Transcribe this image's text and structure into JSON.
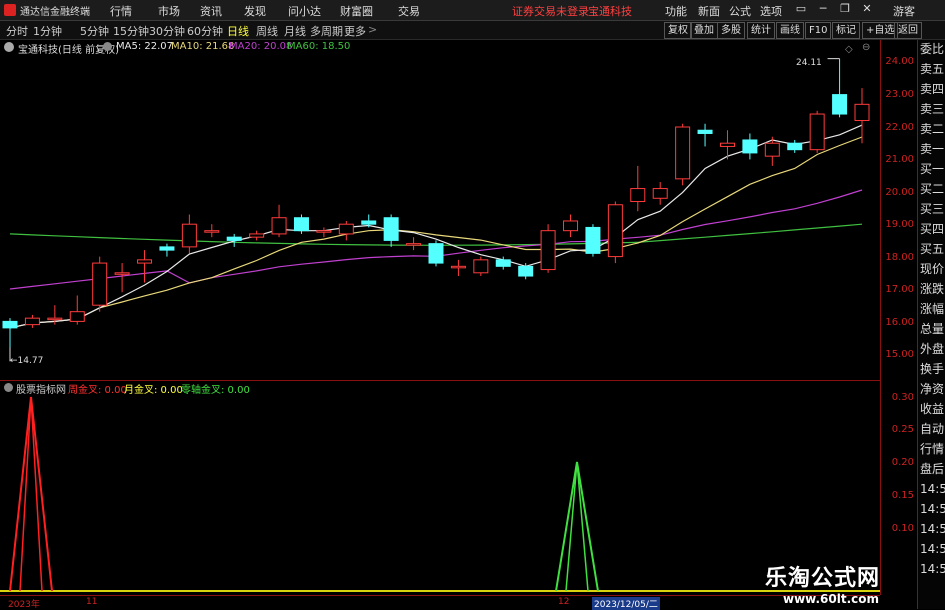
{
  "app": {
    "title": "通达信金融终端",
    "menu": [
      "行情",
      "市场",
      "资讯",
      "发现",
      "问小达",
      "财富圈",
      "交易"
    ],
    "notice": [
      "证券交易未登录",
      "宝通科技"
    ],
    "right_menu": [
      "功能",
      "新面",
      "公式",
      "选项"
    ],
    "guest": "游客"
  },
  "periods": [
    "分时",
    "1分钟",
    "5分钟",
    "15分钟",
    "30分钟",
    "60分钟",
    "日线",
    "周线",
    "月线",
    "多周期",
    "更多"
  ],
  "active_period": "日线",
  "right_tools": [
    "复权",
    "叠加",
    "多股",
    "统计",
    "画线",
    "F10",
    "标记",
    "+自选",
    "返回"
  ],
  "main_chart": {
    "stock": "宝通科技(日线 前复权)",
    "ma": [
      {
        "label": "MA5: 22.07",
        "color": "#e8e8e8"
      },
      {
        "label": "MA10: 21.68",
        "color": "#e8d87a"
      },
      {
        "label": "MA20: 20.08",
        "color": "#c040d0"
      },
      {
        "label": "MA60: 18.50",
        "color": "#40c040"
      }
    ],
    "high_note": "24.11",
    "low_note": "14.77",
    "y_ticks": [
      "24.00",
      "23.00",
      "22.00",
      "21.00",
      "20.00",
      "19.00",
      "18.00",
      "17.00",
      "16.00",
      "15.00"
    ]
  },
  "indicator": {
    "name": "股票指标网",
    "items": [
      {
        "label": "周金叉: 0.00",
        "color": "#ff3030"
      },
      {
        "label": "月金叉: 0.00",
        "color": "#ffff40"
      },
      {
        "label": "零轴金叉: 0.00",
        "color": "#40e040"
      }
    ],
    "y_ticks": [
      "0.30",
      "0.25",
      "0.20",
      "0.15",
      "0.10"
    ]
  },
  "x_axis": [
    "2023年",
    "11",
    "12",
    "2023/12/05/二"
  ],
  "sidebar": [
    "委比",
    "卖五",
    "卖四",
    "卖三",
    "卖二",
    "卖一",
    "买一",
    "买二",
    "买三",
    "买四",
    "买五",
    "现价",
    "涨跌",
    "涨幅",
    "总量",
    "外盘",
    "换手",
    "净资",
    "收益",
    "自动",
    "行情",
    "盘后",
    "14:5",
    "14:5",
    "14:5",
    "14:5",
    "14:5"
  ],
  "watermark": {
    "title": "乐淘公式网",
    "url": "www.60lt.com"
  },
  "chart_data": {
    "type": "candlestick",
    "ylim": [
      14.5,
      24.5
    ],
    "candles": [
      {
        "o": 16.0,
        "c": 15.8,
        "h": 16.1,
        "l": 14.77
      },
      {
        "o": 15.9,
        "c": 16.1,
        "h": 16.2,
        "l": 15.8
      },
      {
        "o": 16.1,
        "c": 16.1,
        "h": 16.5,
        "l": 15.9
      },
      {
        "o": 16.0,
        "c": 16.3,
        "h": 16.8,
        "l": 15.9
      },
      {
        "o": 16.5,
        "c": 17.8,
        "h": 18.0,
        "l": 16.3
      },
      {
        "o": 17.5,
        "c": 17.5,
        "h": 17.8,
        "l": 16.9
      },
      {
        "o": 17.8,
        "c": 17.9,
        "h": 18.2,
        "l": 17.2
      },
      {
        "o": 18.3,
        "c": 18.2,
        "h": 18.4,
        "l": 18.0
      },
      {
        "o": 18.3,
        "c": 19.0,
        "h": 19.3,
        "l": 18.1
      },
      {
        "o": 18.8,
        "c": 18.8,
        "h": 19.0,
        "l": 18.6
      },
      {
        "o": 18.6,
        "c": 18.5,
        "h": 18.7,
        "l": 18.3
      },
      {
        "o": 18.6,
        "c": 18.7,
        "h": 18.8,
        "l": 18.5
      },
      {
        "o": 18.7,
        "c": 19.2,
        "h": 19.6,
        "l": 18.6
      },
      {
        "o": 19.2,
        "c": 18.8,
        "h": 19.3,
        "l": 18.7
      },
      {
        "o": 18.8,
        "c": 18.8,
        "h": 18.9,
        "l": 18.6
      },
      {
        "o": 18.7,
        "c": 19.0,
        "h": 19.1,
        "l": 18.5
      },
      {
        "o": 19.1,
        "c": 19.0,
        "h": 19.3,
        "l": 18.9
      },
      {
        "o": 19.2,
        "c": 18.5,
        "h": 19.3,
        "l": 18.3
      },
      {
        "o": 18.4,
        "c": 18.4,
        "h": 18.6,
        "l": 18.2
      },
      {
        "o": 18.4,
        "c": 17.8,
        "h": 18.5,
        "l": 17.7
      },
      {
        "o": 17.7,
        "c": 17.7,
        "h": 17.9,
        "l": 17.4
      },
      {
        "o": 17.5,
        "c": 17.9,
        "h": 18.0,
        "l": 17.4
      },
      {
        "o": 17.9,
        "c": 17.7,
        "h": 18.0,
        "l": 17.6
      },
      {
        "o": 17.7,
        "c": 17.4,
        "h": 17.8,
        "l": 17.3
      },
      {
        "o": 17.6,
        "c": 18.8,
        "h": 19.0,
        "l": 17.5
      },
      {
        "o": 18.8,
        "c": 19.1,
        "h": 19.3,
        "l": 18.6
      },
      {
        "o": 18.9,
        "c": 18.1,
        "h": 19.0,
        "l": 18.0
      },
      {
        "o": 18.0,
        "c": 19.6,
        "h": 19.7,
        "l": 17.8
      },
      {
        "o": 19.7,
        "c": 20.1,
        "h": 20.8,
        "l": 19.4
      },
      {
        "o": 19.8,
        "c": 20.1,
        "h": 20.3,
        "l": 19.6
      },
      {
        "o": 20.4,
        "c": 22.0,
        "h": 22.1,
        "l": 20.2
      },
      {
        "o": 21.9,
        "c": 21.8,
        "h": 22.1,
        "l": 21.4
      },
      {
        "o": 21.4,
        "c": 21.5,
        "h": 21.9,
        "l": 21.0
      },
      {
        "o": 21.6,
        "c": 21.2,
        "h": 21.8,
        "l": 21.0
      },
      {
        "o": 21.1,
        "c": 21.5,
        "h": 21.7,
        "l": 20.8
      },
      {
        "o": 21.5,
        "c": 21.3,
        "h": 21.6,
        "l": 21.2
      },
      {
        "o": 21.3,
        "c": 22.4,
        "h": 22.5,
        "l": 21.2
      },
      {
        "o": 23.0,
        "c": 22.4,
        "h": 24.11,
        "l": 22.3
      },
      {
        "o": 22.2,
        "c": 22.7,
        "h": 23.2,
        "l": 21.5
      }
    ]
  }
}
